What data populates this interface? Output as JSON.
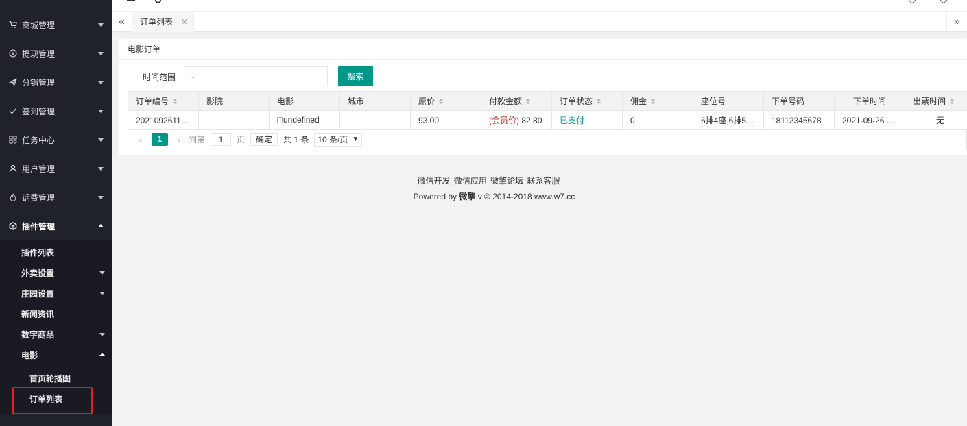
{
  "sidebar": {
    "items": [
      {
        "label": "商城管理",
        "icon": "cart-icon"
      },
      {
        "label": "提现管理",
        "icon": "yen-icon"
      },
      {
        "label": "分销管理",
        "icon": "send-icon"
      },
      {
        "label": "签到管理",
        "icon": "check-icon"
      },
      {
        "label": "任务中心",
        "icon": "apps-icon"
      },
      {
        "label": "用户管理",
        "icon": "user-icon"
      },
      {
        "label": "话费管理",
        "icon": "fire-icon"
      },
      {
        "label": "插件管理",
        "icon": "box-icon"
      }
    ],
    "plugins": {
      "items": [
        {
          "label": "插件列表"
        },
        {
          "label": "外卖设置"
        },
        {
          "label": "庄园设置"
        },
        {
          "label": "新闻资讯"
        },
        {
          "label": "数字商品"
        },
        {
          "label": "电影"
        }
      ],
      "movie": {
        "items": [
          {
            "label": "首页轮播图"
          },
          {
            "label": "订单列表"
          }
        ]
      }
    }
  },
  "tabs": [
    {
      "label": "订单列表"
    }
  ],
  "card": {
    "title": "电影订单",
    "search": {
      "label": "时间范围",
      "placeholder": "-",
      "button": "搜索"
    }
  },
  "table": {
    "columns": [
      "订单编号",
      "影院",
      "电影",
      "城市",
      "原价",
      "付款金额",
      "订单状态",
      "佣金",
      "座位号",
      "下单号码",
      "下单时间",
      "出票时间"
    ],
    "rows": [
      {
        "order_no": "2021092611…",
        "cinema": "",
        "movie": "undefined",
        "city": "",
        "price": "93.00",
        "pay_prefix": "(会员价)",
        "pay_amount": "82.80",
        "status": "已支付",
        "commission": "0",
        "seat": "6排4座,6排5…",
        "phone": "18112345678",
        "order_time": "2021-09-26 …",
        "ticket_time": "无"
      }
    ]
  },
  "pager": {
    "current": "1",
    "goto_label": "到第",
    "goto_value": "1",
    "page_unit": "页",
    "confirm": "确定",
    "total": "共 1 条",
    "page_size": "10 条/页"
  },
  "footer": {
    "links": [
      "微信开发",
      "微信应用",
      "微擎论坛",
      "联系客服"
    ],
    "powered_prefix": "Powered by ",
    "brand": "微擎",
    "powered_suffix": " v © 2014-2018 www.w7.cc"
  },
  "colors": {
    "accent": "#009688",
    "sidebar_bg": "#20222a",
    "highlight": "#e31f1f",
    "member_price": "#c03a2b"
  }
}
